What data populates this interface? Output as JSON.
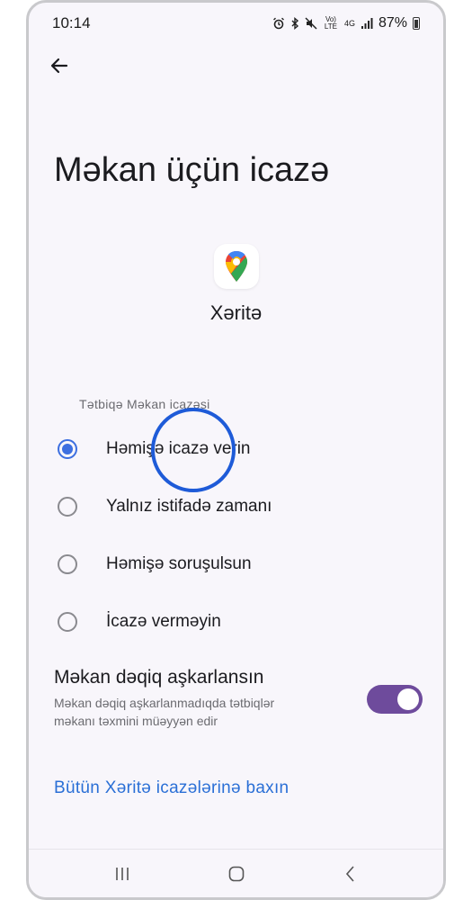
{
  "status_bar": {
    "time": "10:14",
    "battery": "87%",
    "icons": [
      "alarm-icon",
      "bluetooth-icon",
      "mute-icon",
      "volte-icon",
      "4g-icon",
      "signal-icon",
      "battery-icon"
    ],
    "volte_text": "Vo) LTE",
    "network_text": "4G"
  },
  "page": {
    "title": "Məkan üçün icazə",
    "app_name": "Xəritə",
    "section_label": "Tətbiqə Məkan icazəsi"
  },
  "options": [
    {
      "label": "Həmişə icazə verin",
      "checked": true
    },
    {
      "label": "Yalnız istifadə zamanı",
      "checked": false
    },
    {
      "label": "Həmişə soruşulsun",
      "checked": false
    },
    {
      "label": "İcazə verməyin",
      "checked": false
    }
  ],
  "precise": {
    "title": "Məkan dəqiq aşkarlansın",
    "description": "Məkan dəqiq aşkarlanmadıqda tətbiqlər məkanı təxmini müəyyən edir",
    "enabled": true
  },
  "link": {
    "label": "Bütün Xəritə icazələrinə baxın"
  },
  "colors": {
    "accent_radio": "#3d6fe0",
    "toggle_on": "#6e4b9c",
    "link": "#2a6fd6",
    "touch_ring": "#1e5bd8"
  }
}
